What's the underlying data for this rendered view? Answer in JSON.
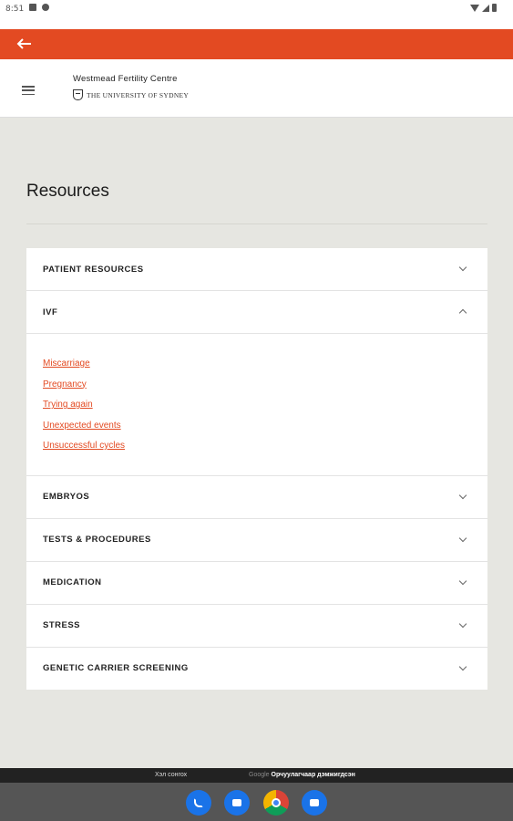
{
  "status_bar": {
    "time": "8:51"
  },
  "header": {
    "title": "Westmead Fertility Centre",
    "university": "THE UNIVERSITY OF SYDNEY"
  },
  "page": {
    "title": "Resources"
  },
  "accordion": {
    "patient_resources": "PATIENT RESOURCES",
    "ivf": "IVF",
    "ivf_links": [
      "Miscarriage",
      "Pregnancy",
      "Trying again",
      "Unexpected events",
      "Unsuccessful cycles"
    ],
    "embryos": "EMBRYOS",
    "tests": "TESTS & PROCEDURES",
    "medication": "MEDICATION",
    "stress": "STRESS",
    "genetic": "GENETIC CARRIER SCREENING"
  },
  "nav_banner": {
    "left": "Хэл сонгох",
    "right_brand": "Google",
    "right_text": "Орчуулагчаар дэмжигдсэн"
  },
  "colors": {
    "accent": "#e34a22",
    "background": "#e6e6e1"
  },
  "icons": [
    "back-arrow-icon",
    "menu-icon",
    "chevron-down-icon",
    "chevron-up-icon",
    "phone-icon",
    "messages-icon",
    "chrome-icon",
    "camera-icon"
  ]
}
